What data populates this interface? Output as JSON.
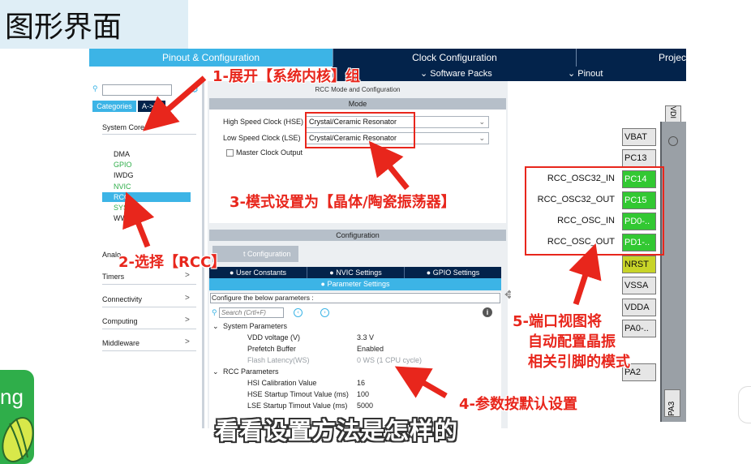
{
  "slide": {
    "title": "图形界面",
    "caption": "看看设置方法是怎样的"
  },
  "logo": {
    "text": "ng"
  },
  "top_tabs": {
    "pinout": "Pinout & Configuration",
    "clock": "Clock Configuration",
    "project": "Projec",
    "software_packs": "Software Packs",
    "pinout_sub": "Pinout"
  },
  "left_panel": {
    "search_placeholder": "",
    "categories_btn": "Categories",
    "az_btn": "A->Z",
    "system_core": "System Core",
    "system_core_items": [
      {
        "label": "DMA",
        "color": "#1a1a1a"
      },
      {
        "label": "GPIO",
        "color": "#2fae4a"
      },
      {
        "label": "IWDG",
        "color": "#1a1a1a"
      },
      {
        "label": "NVIC",
        "color": "#2fae4a"
      },
      {
        "label": "RCC",
        "color": "#ffffff"
      },
      {
        "label": "SYS",
        "color": "#2fae4a"
      },
      {
        "label": "WW",
        "color": "#1a1a1a"
      }
    ],
    "analog": "Analo",
    "timers": "Timers",
    "connectivity": "Connectivity",
    "computing": "Computing",
    "middleware": "Middleware"
  },
  "mode_panel": {
    "header": "RCC Mode and Configuration",
    "mode_bar": "Mode",
    "hse_label": "High Speed Clock (HSE)",
    "hse_value": "Crystal/Ceramic Resonator",
    "lse_label": "Low Speed Clock (LSE)",
    "lse_value": "Crystal/Ceramic Resonator",
    "master_clock_output": "Master Clock Output"
  },
  "config_panel": {
    "bar": "Configuration",
    "reset_btn": "t Configuration",
    "tabs": [
      "User Constants",
      "NVIC Settings",
      "GPIO Settings"
    ],
    "param_tab": "Parameter Settings",
    "configure_text": "Configure the below parameters :",
    "search_placeholder": "Search (Crtl+F)",
    "system_params_heading": "System Parameters",
    "system_params": [
      {
        "name": "VDD voltage (V)",
        "value": "3.3 V",
        "muted": false
      },
      {
        "name": "Prefetch Buffer",
        "value": "Enabled",
        "muted": false
      },
      {
        "name": "Flash Latency(WS)",
        "value": "0 WS (1 CPU cycle)",
        "muted": true
      }
    ],
    "rcc_params_heading": "RCC Parameters",
    "rcc_params": [
      {
        "name": "HSI Calibration Value",
        "value": "16"
      },
      {
        "name": "HSE Startup Timout Value (ms)",
        "value": "100"
      },
      {
        "name": "LSE Startup Timout Value (ms)",
        "value": "5000"
      }
    ]
  },
  "pinout": {
    "vdd_top": "VDI",
    "pins": [
      {
        "name": "VBAT",
        "label": "",
        "color": "#e6e6e6"
      },
      {
        "name": "PC13",
        "label": "",
        "color": "#e6e6e6"
      },
      {
        "name": "PC14",
        "label": "RCC_OSC32_IN",
        "color": "#32c832"
      },
      {
        "name": "PC15",
        "label": "RCC_OSC32_OUT",
        "color": "#32c832"
      },
      {
        "name": "PD0-..",
        "label": "RCC_OSC_IN",
        "color": "#32c832"
      },
      {
        "name": "PD1-..",
        "label": "RCC_OSC_OUT",
        "color": "#32c832"
      },
      {
        "name": "NRST",
        "label": "",
        "color": "#c8d428"
      },
      {
        "name": "VSSA",
        "label": "",
        "color": "#e6e6e6"
      },
      {
        "name": "VDDA",
        "label": "",
        "color": "#e6e6e6"
      },
      {
        "name": "PA0-..",
        "label": "",
        "color": "#e6e6e6"
      },
      {
        "name": "PA2",
        "label": "",
        "color": "#e6e6e6"
      }
    ],
    "pa3": "PA3"
  },
  "annotations": {
    "step1": "1-展开【系统内核】组",
    "step2": "2-选择【RCC】",
    "step3": "3-模式设置为【晶体/陶瓷振荡器】",
    "step4": "4-参数按默认设置",
    "step5_line1": "5-端口视图将",
    "step5_line2": "自动配置晶振",
    "step5_line3": "相关引脚的模式"
  },
  "colors": {
    "accent": "#3cb4e6",
    "navy": "#03234b",
    "annotation_red": "#e8261c",
    "pin_green": "#32c832"
  }
}
